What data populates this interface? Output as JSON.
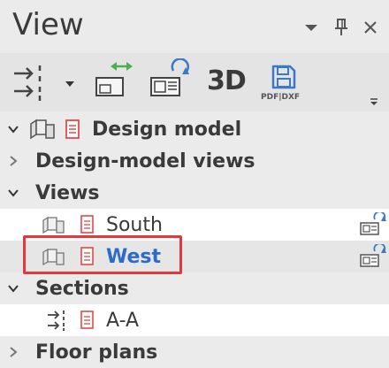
{
  "panel": {
    "title": "View",
    "header_buttons": [
      "dropdown-arrow-icon",
      "pin-icon",
      "close-icon"
    ]
  },
  "toolbar": {
    "tools": [
      {
        "name": "section-tool",
        "icon": "section-arrows-icon"
      },
      {
        "name": "section-dropdown",
        "icon": "dropdown-arrow-icon"
      },
      {
        "name": "swap-views",
        "icon": "swap-views-icon"
      },
      {
        "name": "refresh-view",
        "icon": "refresh-view-icon"
      },
      {
        "name": "3d-view",
        "label": "3D"
      },
      {
        "name": "save-pdf-dxf",
        "icon": "save-icon",
        "label": "PDF|DXF"
      }
    ],
    "label_3d": "3D",
    "label_pdf": "PDF|DXF"
  },
  "tree": {
    "design_model": "Design model",
    "design_model_views": "Design-model views",
    "views": "Views",
    "view_items": [
      {
        "label": "South",
        "selected": false
      },
      {
        "label": "West",
        "selected": true
      }
    ],
    "sections": "Sections",
    "section_items": [
      {
        "label": "A-A"
      }
    ],
    "floor_plans": "Floor plans"
  },
  "colors": {
    "panel_bg": "#ebebeb",
    "toolbar_bg": "#e4e4e4",
    "row_white": "#ffffff",
    "selected_row": "#e6e6e6",
    "selected_text": "#2d6bc9",
    "save_icon": "#3a78c9",
    "refresh_icon": "#3a78c9",
    "swap_arrow": "#4caf50",
    "document_icon": "#e24a4a",
    "highlight_border": "#e4393b"
  }
}
